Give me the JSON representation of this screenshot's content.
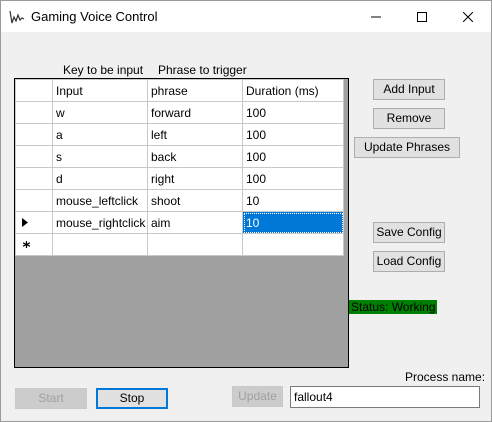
{
  "window": {
    "title": "Gaming Voice Control"
  },
  "labels": {
    "key_header": "Key to be input",
    "phrase_header": "Phrase to trigger",
    "process_name": "Process name:"
  },
  "grid": {
    "columns": [
      "Input",
      "phrase",
      "Duration (ms)"
    ],
    "rows": [
      {
        "input": "w",
        "phrase": "forward",
        "duration": "100"
      },
      {
        "input": "a",
        "phrase": "left",
        "duration": "100"
      },
      {
        "input": "s",
        "phrase": "back",
        "duration": "100"
      },
      {
        "input": "d",
        "phrase": "right",
        "duration": "100"
      },
      {
        "input": "mouse_leftclick",
        "phrase": "shoot",
        "duration": "10"
      },
      {
        "input": "mouse_rightclick",
        "phrase": "aim",
        "duration": "10"
      }
    ],
    "current_row": 5,
    "selected_cell": "duration",
    "icons": {
      "current_row": "row-pointer-icon",
      "new_row": "new-row-asterisk-icon"
    }
  },
  "buttons": {
    "add_input": "Add Input",
    "remove": "Remove",
    "update_phrases": "Update Phrases",
    "save_config": "Save Config",
    "load_config": "Load Config",
    "start": "Start",
    "stop": "Stop",
    "update": "Update"
  },
  "status": {
    "text": "Status: Working",
    "color": "#008000"
  },
  "process": {
    "value": "fallout4"
  },
  "colors": {
    "selection": "#0078d7"
  }
}
